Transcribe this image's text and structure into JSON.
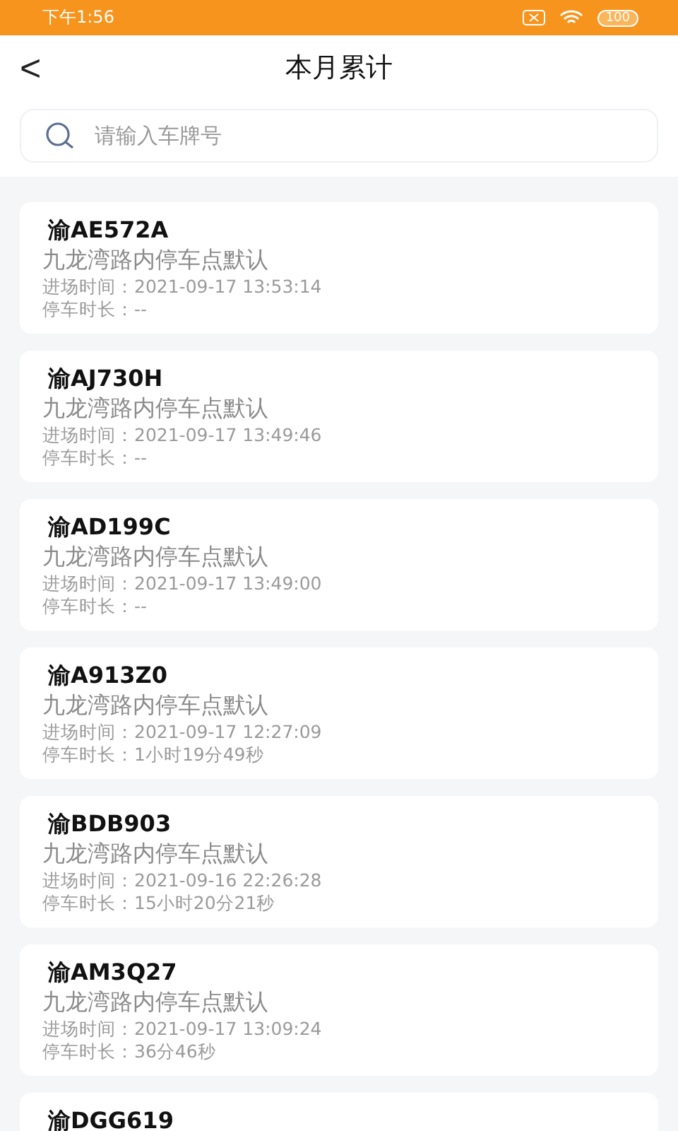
{
  "status_bar": {
    "time": "下午1:56",
    "battery": "100"
  },
  "header": {
    "back": "<",
    "title": "本月累计"
  },
  "search": {
    "placeholder": "请输入车牌号"
  },
  "records": [
    {
      "plate": "渝AE572A",
      "location": "九龙湾路内停车点默认",
      "entry": "进场时间：2021-09-17 13:53:14",
      "duration": "停车时长：--"
    },
    {
      "plate": "渝AJ730H",
      "location": "九龙湾路内停车点默认",
      "entry": "进场时间：2021-09-17 13:49:46",
      "duration": "停车时长：--"
    },
    {
      "plate": "渝AD199C",
      "location": "九龙湾路内停车点默认",
      "entry": "进场时间：2021-09-17 13:49:00",
      "duration": "停车时长：--"
    },
    {
      "plate": "渝A913Z0",
      "location": "九龙湾路内停车点默认",
      "entry": "进场时间：2021-09-17 12:27:09",
      "duration": "停车时长：1小时19分49秒"
    },
    {
      "plate": "渝BDB903",
      "location": "九龙湾路内停车点默认",
      "entry": "进场时间：2021-09-16 22:26:28",
      "duration": "停车时长：15小时20分21秒"
    },
    {
      "plate": "渝AM3Q27",
      "location": "九龙湾路内停车点默认",
      "entry": "进场时间：2021-09-17 13:09:24",
      "duration": "停车时长：36分46秒"
    },
    {
      "plate": "渝DGG619"
    }
  ]
}
